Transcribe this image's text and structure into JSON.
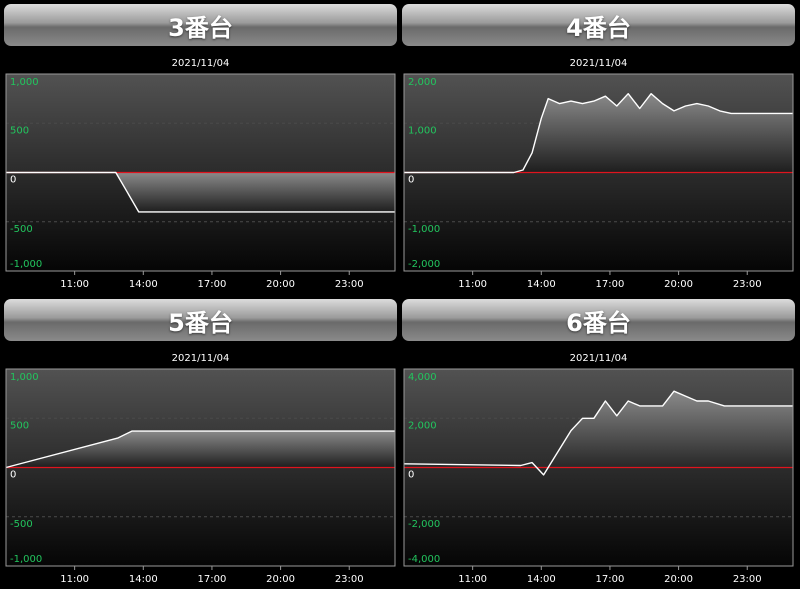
{
  "panels": [
    {
      "title": "3番台",
      "chart_data": {
        "type": "area",
        "title": "2021/11/04",
        "ylim": [
          -1000,
          1000
        ],
        "yticks": [
          1000,
          500,
          0,
          -500,
          -1000
        ],
        "ytick_labels": [
          "1,000",
          "500",
          "0",
          "-500",
          "-1,000"
        ],
        "xlim": [
          8,
          25
        ],
        "xticks": [
          11,
          14,
          17,
          20,
          23
        ],
        "xtick_labels": [
          "11:00",
          "14:00",
          "17:00",
          "20:00",
          "23:00"
        ],
        "series": [
          {
            "x": [
              8,
              12.8,
              13.3,
              13.8,
              25
            ],
            "y": [
              0,
              0,
              -200,
              -400,
              -400
            ]
          }
        ]
      }
    },
    {
      "title": "4番台",
      "chart_data": {
        "type": "area",
        "title": "2021/11/04",
        "ylim": [
          -2000,
          2000
        ],
        "yticks": [
          2000,
          1000,
          0,
          -1000,
          -2000
        ],
        "ytick_labels": [
          "2,000",
          "1,000",
          "0",
          "-1,000",
          "-2,000"
        ],
        "xlim": [
          8,
          25
        ],
        "xticks": [
          11,
          14,
          17,
          20,
          23
        ],
        "xtick_labels": [
          "11:00",
          "14:00",
          "17:00",
          "20:00",
          "23:00"
        ],
        "series": [
          {
            "x": [
              8,
              12.8,
              13.2,
              13.6,
              14.0,
              14.3,
              14.8,
              15.3,
              15.8,
              16.3,
              16.8,
              17.3,
              17.8,
              18.3,
              18.8,
              19.3,
              19.8,
              20.3,
              20.8,
              21.3,
              21.8,
              22.3,
              23.0,
              25
            ],
            "y": [
              0,
              0,
              50,
              400,
              1100,
              1500,
              1400,
              1450,
              1400,
              1450,
              1550,
              1350,
              1600,
              1300,
              1600,
              1400,
              1250,
              1350,
              1400,
              1350,
              1250,
              1200,
              1200,
              1200
            ]
          }
        ]
      }
    },
    {
      "title": "5番台",
      "chart_data": {
        "type": "area",
        "title": "2021/11/04",
        "ylim": [
          -1000,
          1000
        ],
        "yticks": [
          1000,
          500,
          0,
          -500,
          -1000
        ],
        "ytick_labels": [
          "1,000",
          "500",
          "0",
          "-500",
          "-1,000"
        ],
        "xlim": [
          8,
          25
        ],
        "xticks": [
          11,
          14,
          17,
          20,
          23
        ],
        "xtick_labels": [
          "11:00",
          "14:00",
          "17:00",
          "20:00",
          "23:00"
        ],
        "series": [
          {
            "x": [
              8,
              12.9,
              13.5,
              25
            ],
            "y": [
              0,
              300,
              370,
              370
            ]
          }
        ]
      }
    },
    {
      "title": "6番台",
      "chart_data": {
        "type": "area",
        "title": "2021/11/04",
        "ylim": [
          -4000,
          4000
        ],
        "yticks": [
          4000,
          2000,
          0,
          -2000,
          -4000
        ],
        "ytick_labels": [
          "4,000",
          "2,000",
          "0",
          "-2,000",
          "-4,000"
        ],
        "xlim": [
          8,
          25
        ],
        "xticks": [
          11,
          14,
          17,
          20,
          23
        ],
        "xtick_labels": [
          "11:00",
          "14:00",
          "17:00",
          "20:00",
          "23:00"
        ],
        "series": [
          {
            "x": [
              8,
              13.1,
              13.6,
              14.1,
              15.3,
              15.8,
              16.3,
              16.8,
              17.3,
              17.8,
              18.3,
              18.8,
              19.3,
              19.8,
              20.3,
              20.8,
              21.3,
              22.0,
              23.0,
              25
            ],
            "y": [
              150,
              80,
              200,
              -300,
              1500,
              2000,
              2000,
              2700,
              2100,
              2700,
              2500,
              2500,
              2500,
              3100,
              2900,
              2700,
              2700,
              2500,
              2500,
              2500
            ]
          }
        ]
      }
    }
  ],
  "colors": {
    "plot_bg_top": "#525252",
    "plot_bg_bottom": "#050505",
    "fill_top": "#8a8a8a",
    "fill_bottom": "#1e1e1e",
    "line": "#ffffff",
    "zero_line": "#e0141e",
    "y_label": "#22c55e",
    "zero_label": "#ffffff",
    "x_label": "#ffffff",
    "date_label": "#ffffff",
    "axis": "#9a9a9a",
    "grid": "#4a4a4a"
  }
}
